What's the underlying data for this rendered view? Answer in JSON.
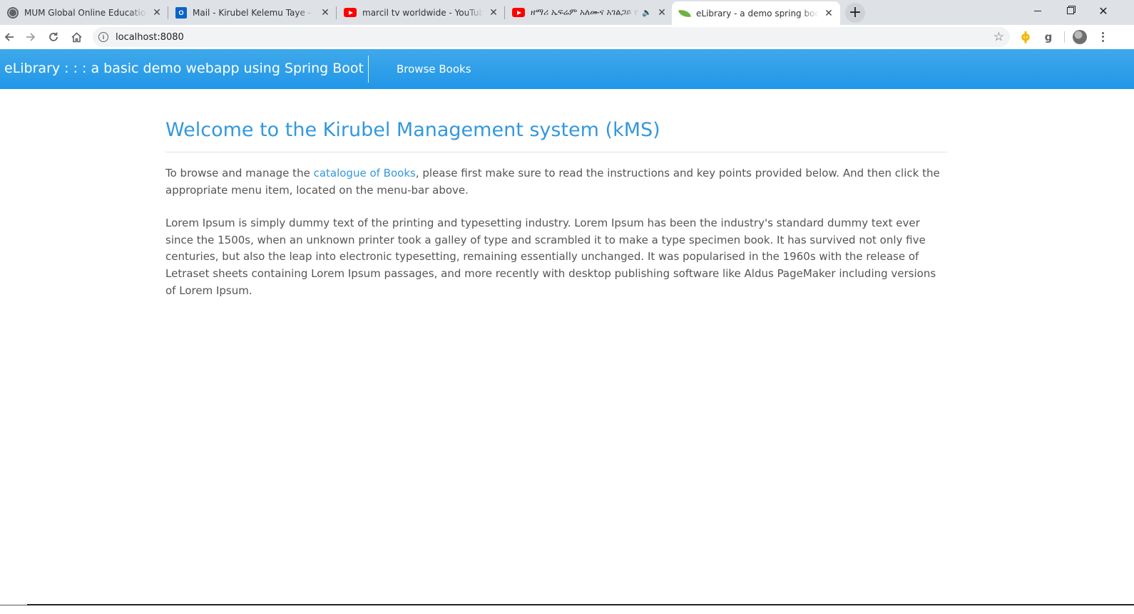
{
  "browser": {
    "tabs": [
      {
        "title": "MUM Global Online Education : Online",
        "favicon": "globe-icon"
      },
      {
        "title": "Mail - Kirubel Kelemu Taye - Outlook",
        "favicon": "outlook-icon"
      },
      {
        "title": "marcil tv worldwide - YouTube",
        "favicon": "youtube-icon"
      },
      {
        "title": "ዘማሪ ኤፍሬም አለሙና አገልጋይ ዮ",
        "favicon": "youtube-icon",
        "audio": "speaker-icon"
      },
      {
        "title": "eLibrary - a demo spring boot webapp",
        "favicon": "spring-leaf-icon",
        "active": true
      }
    ],
    "new_tab": "+",
    "address": "localhost:8080",
    "close_glyph": "✕"
  },
  "navbar": {
    "brand": "eLibrary : : : a basic demo webapp using Spring Boot",
    "links": [
      "Browse Books"
    ],
    "color": "#2a9fea"
  },
  "main": {
    "title": "Welcome to the Kirubel Management system (kMS)",
    "intro_before": "To browse and manage the ",
    "intro_link": "catalogue of Books",
    "intro_after": ", please first make sure to read the instructions and key points provided below. And then click the appropriate menu item, located on the menu-bar above.",
    "lorem": "Lorem Ipsum is simply dummy text of the printing and typesetting industry. Lorem Ipsum has been the industry's standard dummy text ever since the 1500s, when an unknown printer took a galley of type and scrambled it to make a type specimen book. It has survived not only five centuries, but also the leap into electronic typesetting, remaining essentially unchanged. It was popularised in the 1960s with the release of Letraset sheets containing Lorem Ipsum passages, and more recently with desktop publishing software like Aldus PageMaker including versions of Lorem Ipsum.",
    "accent_color": "#3498db"
  }
}
